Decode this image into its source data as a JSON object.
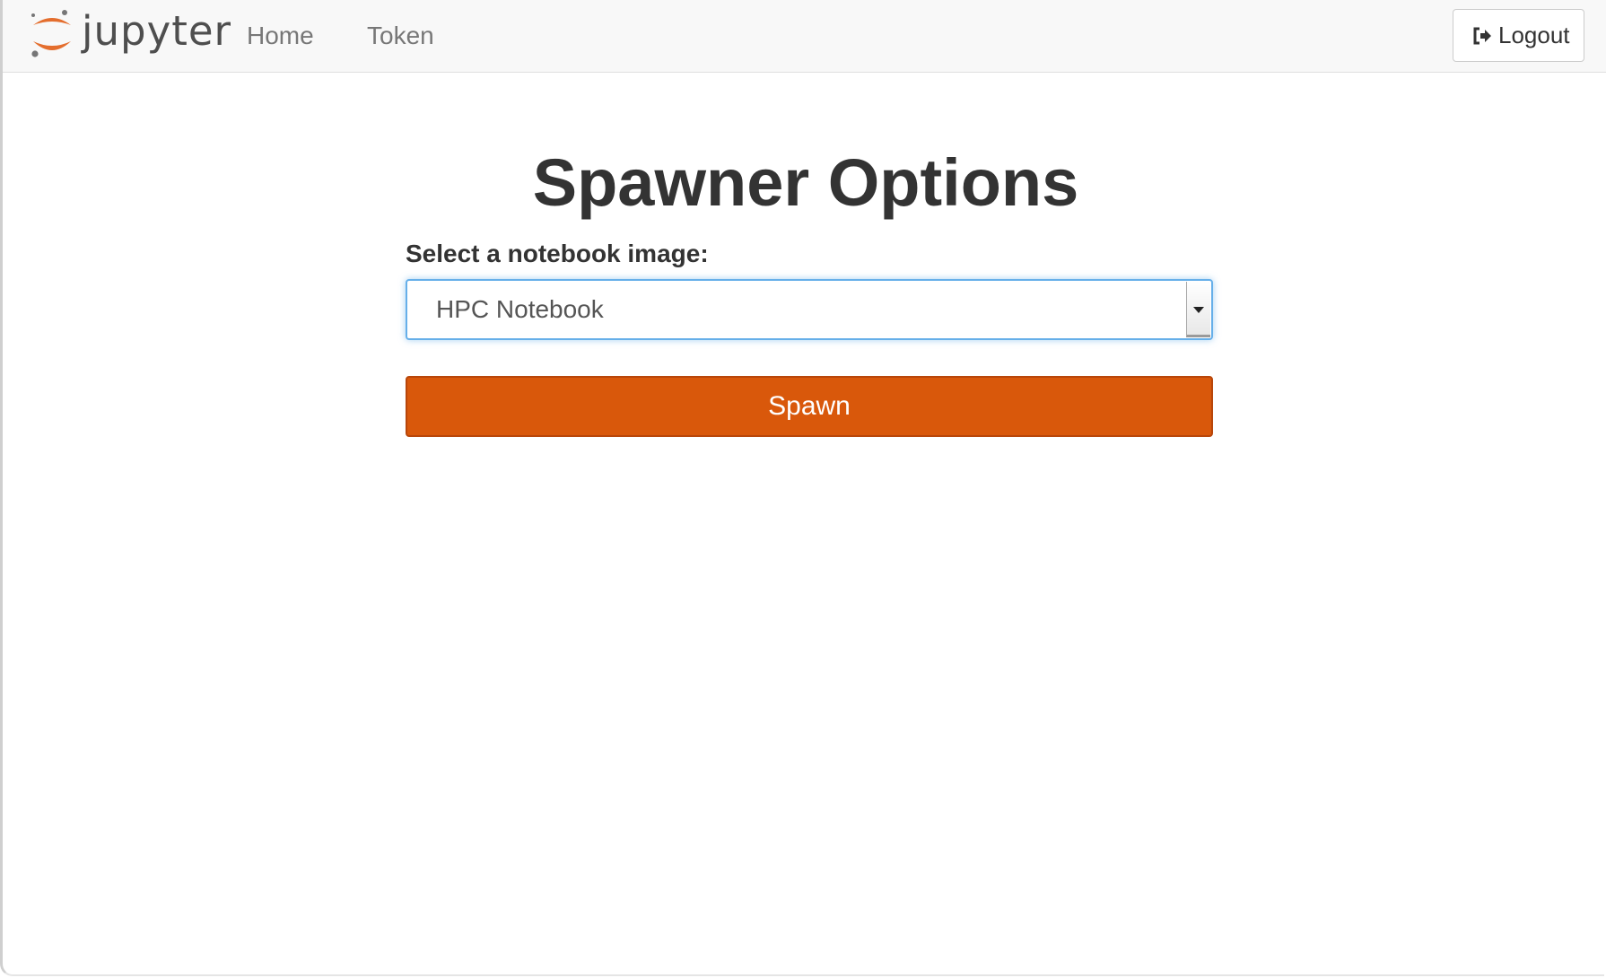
{
  "header": {
    "brand": "jupyter",
    "nav": [
      {
        "label": "Home"
      },
      {
        "label": "Token"
      }
    ],
    "logout_label": "Logout"
  },
  "main": {
    "title": "Spawner Options",
    "image_select": {
      "label": "Select a notebook image:",
      "selected": "HPC Notebook"
    },
    "spawn_label": "Spawn"
  },
  "colors": {
    "accent": "#d9580b",
    "logo_orange": "#e46e2e",
    "focus_border": "#66afe9"
  },
  "icons": {
    "logo": "jupyter-logo-icon",
    "logout": "sign-out-icon",
    "select": "caret-down-icon"
  }
}
